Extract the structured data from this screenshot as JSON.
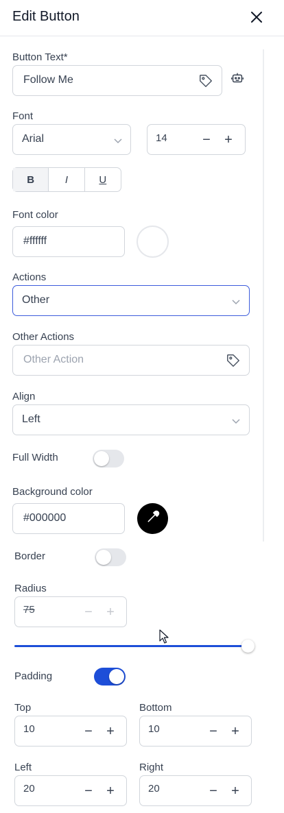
{
  "header": {
    "title": "Edit Button"
  },
  "button_text": {
    "label": "Button Text*",
    "value": "Follow Me"
  },
  "font": {
    "label": "Font",
    "family": "Arial",
    "size": "14"
  },
  "format": {
    "bold": "B",
    "italic": "I",
    "underline": "U"
  },
  "font_color": {
    "label": "Font color",
    "value": "#ffffff",
    "swatch": "#ffffff"
  },
  "actions": {
    "label": "Actions",
    "selected": "Other"
  },
  "other_actions": {
    "label": "Other Actions",
    "placeholder": "Other Action"
  },
  "align": {
    "label": "Align",
    "selected": "Left"
  },
  "full_width": {
    "label": "Full Width",
    "on": false
  },
  "background_color": {
    "label": "Background color",
    "value": "#000000",
    "swatch": "#000000"
  },
  "border": {
    "label": "Border",
    "on": false
  },
  "radius": {
    "label": "Radius",
    "value": "75",
    "slider_fraction": 1.0
  },
  "padding": {
    "label": "Padding",
    "on": true,
    "top": {
      "label": "Top",
      "value": "10"
    },
    "bottom": {
      "label": "Bottom",
      "value": "10"
    },
    "left": {
      "label": "Left",
      "value": "20"
    },
    "right": {
      "label": "Right",
      "value": "20"
    }
  },
  "colors": {
    "accent": "#1d4ed8",
    "focus_border": "#3b5bdb"
  },
  "icons": [
    "close-icon",
    "tag-icon",
    "robot-icon",
    "chevron-down-icon",
    "eyedropper-icon",
    "minus-icon",
    "plus-icon",
    "cursor-icon"
  ]
}
